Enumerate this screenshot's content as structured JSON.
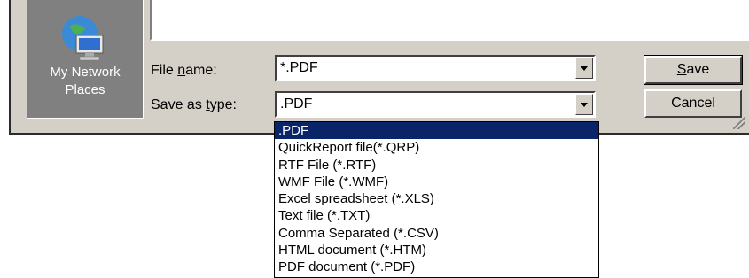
{
  "places": {
    "label": "My Network\nPlaces",
    "icon": "network-computer-icon"
  },
  "file_name": {
    "label_pre": "File ",
    "label_access": "n",
    "label_post": "ame:",
    "value": "*.PDF"
  },
  "save_type": {
    "label_pre": "Save as ",
    "label_access": "t",
    "label_post": "ype:",
    "value": ".PDF"
  },
  "buttons": {
    "save_access": "S",
    "save_rest": "ave",
    "cancel": "Cancel"
  },
  "dropdown": {
    "items": [
      ".PDF",
      "QuickReport file(*.QRP)",
      "RTF File (*.RTF)",
      "WMF File (*.WMF)",
      "Excel spreadsheet (*.XLS)",
      "Text file (*.TXT)",
      "Comma Separated (*.CSV)",
      "HTML document (*.HTM)",
      "PDF document (*.PDF)"
    ],
    "selected": ".PDF"
  },
  "colors": {
    "dialog_bg": "#d4d0c8",
    "places_bg": "#808080",
    "selection": "#0a246a"
  }
}
